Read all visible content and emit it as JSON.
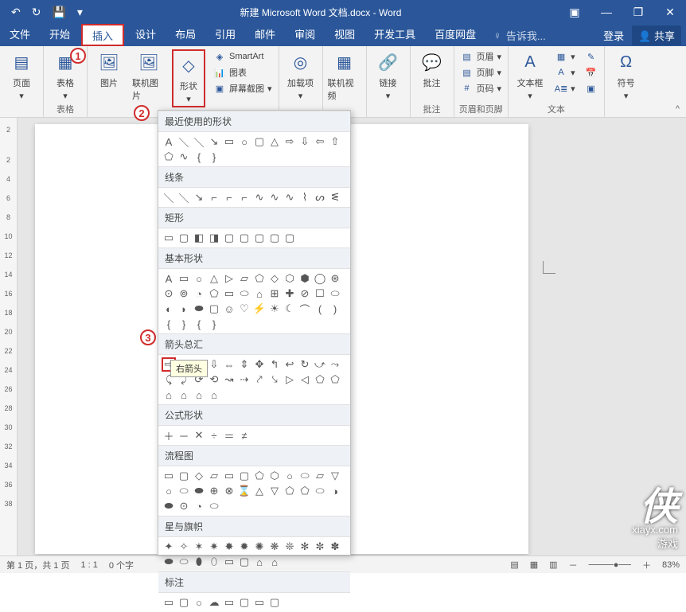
{
  "titlebar": {
    "title": "新建 Microsoft Word 文档.docx - Word"
  },
  "qat": {
    "undo": "↶",
    "redo": "↻",
    "save": "💾",
    "dropdown": "▾"
  },
  "wincontrols": {
    "ribbon_opts": "▣",
    "minimize": "—",
    "restore": "❐",
    "close": "✕"
  },
  "tabs": {
    "file": "文件",
    "home": "开始",
    "insert": "插入",
    "design": "设计",
    "layout": "布局",
    "references": "引用",
    "mailings": "邮件",
    "review": "审阅",
    "view": "视图",
    "developer": "开发工具",
    "baidu": "百度网盘",
    "tellme_icon": "♀",
    "tellme": "告诉我...",
    "login": "登录",
    "share": "共享"
  },
  "ribbon": {
    "pages": {
      "label": "页面",
      "cover": "▦"
    },
    "tables": {
      "label": "表格",
      "btn": "表格",
      "icon": "▦"
    },
    "illustrations": {
      "pictures": "图片",
      "online_pictures": "联机图片",
      "shapes": "形状",
      "smartart": "SmartArt",
      "chart": "图表",
      "screenshot": "屏幕截图"
    },
    "addins": {
      "btn": "加载项"
    },
    "media": {
      "btn": "联机视频"
    },
    "links": {
      "btn": "链接"
    },
    "comments": {
      "btn": "批注",
      "label": "批注"
    },
    "headerfooter": {
      "header": "页眉",
      "footer": "页脚",
      "pagenum": "页码",
      "label": "页眉和页脚"
    },
    "text": {
      "textbox": "文本框",
      "label": "文本"
    },
    "symbols": {
      "btn": "符号"
    }
  },
  "callouts": {
    "c1": "1",
    "c2": "2",
    "c3": "3"
  },
  "dropdown": {
    "recent": "最近使用的形状",
    "lines": "线条",
    "rectangles": "矩形",
    "basic": "基本形状",
    "arrows": "箭头总汇",
    "equation": "公式形状",
    "flowchart": "流程图",
    "stars": "星与旗帜",
    "callouts": "标注",
    "tooltip": "右箭头"
  },
  "ruler_v": [
    "2",
    "",
    "2",
    "4",
    "6",
    "8",
    "10",
    "12",
    "14",
    "16",
    "18",
    "20",
    "22",
    "24",
    "26",
    "28",
    "30",
    "32",
    "34",
    "36",
    "38"
  ],
  "statusbar": {
    "page": "第 1 页，共 1 页",
    "words": "1 : 1",
    "chars": "0 个字",
    "zoom": "83%"
  },
  "watermark": {
    "logo": "侠",
    "site": "xiayx.com",
    "sub": "游戏"
  }
}
